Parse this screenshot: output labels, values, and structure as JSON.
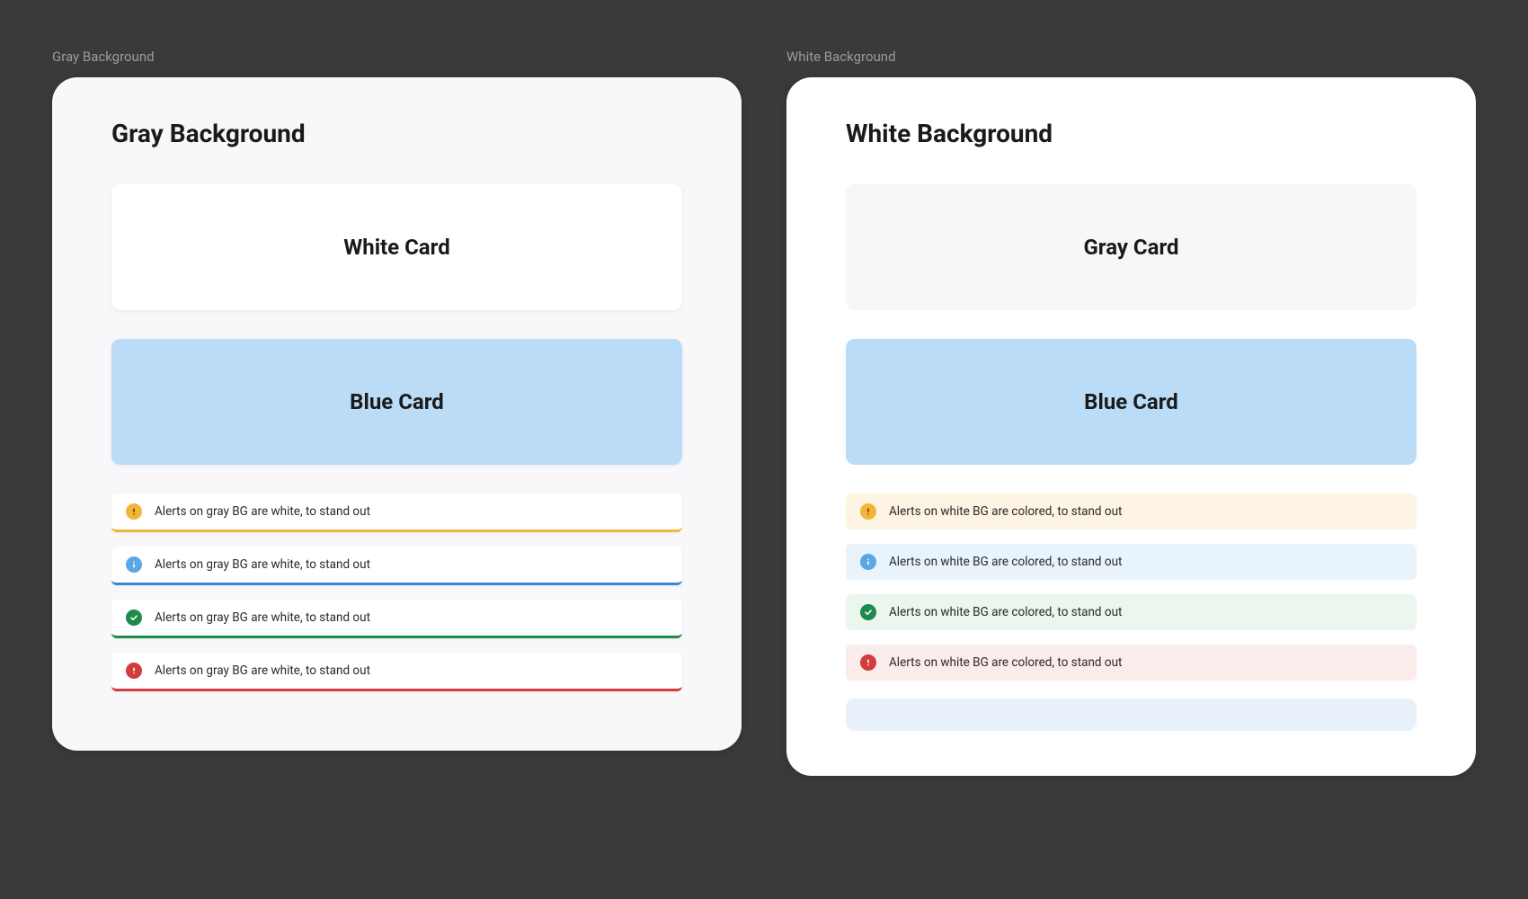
{
  "left": {
    "label": "Gray Background",
    "title": "Gray Background",
    "card_white": "White Card",
    "card_blue": "Blue Card",
    "alert_text": "Alerts on gray BG are white, to stand out"
  },
  "right": {
    "label": "White Background",
    "title": "White Background",
    "card_gray": "Gray Card",
    "card_blue": "Blue Card",
    "alert_text": "Alerts on white BG are colored, to stand out"
  }
}
